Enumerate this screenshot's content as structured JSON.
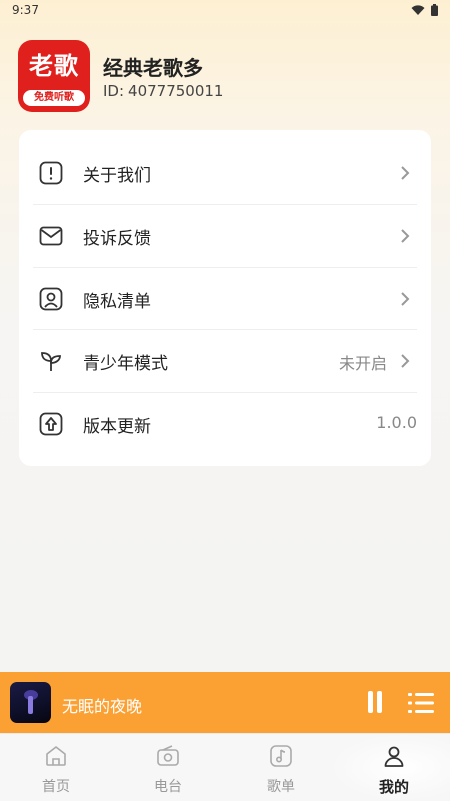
{
  "status_bar": {
    "time": "9:37",
    "icons": [
      "wifi-icon",
      "battery-icon"
    ]
  },
  "profile": {
    "logo_text": "老歌",
    "logo_tagline": "免费听歌",
    "name": "经典老歌多",
    "id_label": "ID:",
    "id_value": "4077750011"
  },
  "menu": {
    "items": [
      {
        "icon": "info-exclamation-icon",
        "label": "关于我们",
        "value": "",
        "chevron": true
      },
      {
        "icon": "mail-icon",
        "label": "投诉反馈",
        "value": "",
        "chevron": true
      },
      {
        "icon": "privacy-user-icon",
        "label": "隐私清单",
        "value": "",
        "chevron": true
      },
      {
        "icon": "sprout-icon",
        "label": "青少年模式",
        "value": "未开启",
        "chevron": true
      },
      {
        "icon": "update-arrow-icon",
        "label": "版本更新",
        "value": "1.0.0",
        "chevron": false
      }
    ]
  },
  "player": {
    "song_title": "无眠的夜晚",
    "state": "playing",
    "accent": "#fba133"
  },
  "tabbar": {
    "tabs": [
      {
        "icon": "home-icon",
        "label": "首页",
        "active": false
      },
      {
        "icon": "radio-icon",
        "label": "电台",
        "active": false
      },
      {
        "icon": "music-note-icon",
        "label": "歌单",
        "active": false
      },
      {
        "icon": "user-icon",
        "label": "我的",
        "active": true
      }
    ]
  },
  "colors": {
    "brand_red": "#e0201c",
    "player_orange": "#fba133",
    "card_bg": "#ffffff"
  }
}
